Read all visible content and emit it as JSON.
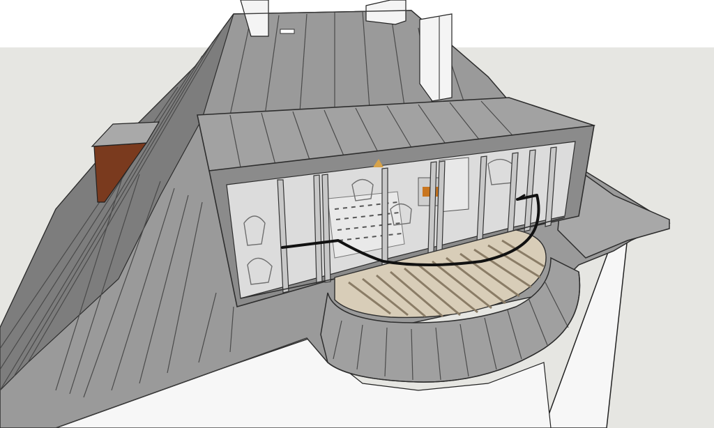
{
  "scene": {
    "kind": "3d-model-viewport",
    "subject": "roof-dormer-with-glazed-balcony",
    "colors": {
      "sky": "#e6e6e2",
      "ground": "#ffffff",
      "roof": "#9a9a9a",
      "roof_dark": "#7d7d7d",
      "roof_light": "#a8a8a8",
      "dormer_face": "#8b8b8b",
      "glass": "#dcdcdc",
      "chimney": "#f4f4f4",
      "brick": "#7a3a1e",
      "deck": "#d8cdb8",
      "railing": "#111111",
      "wall": "#f7f7f7"
    }
  }
}
